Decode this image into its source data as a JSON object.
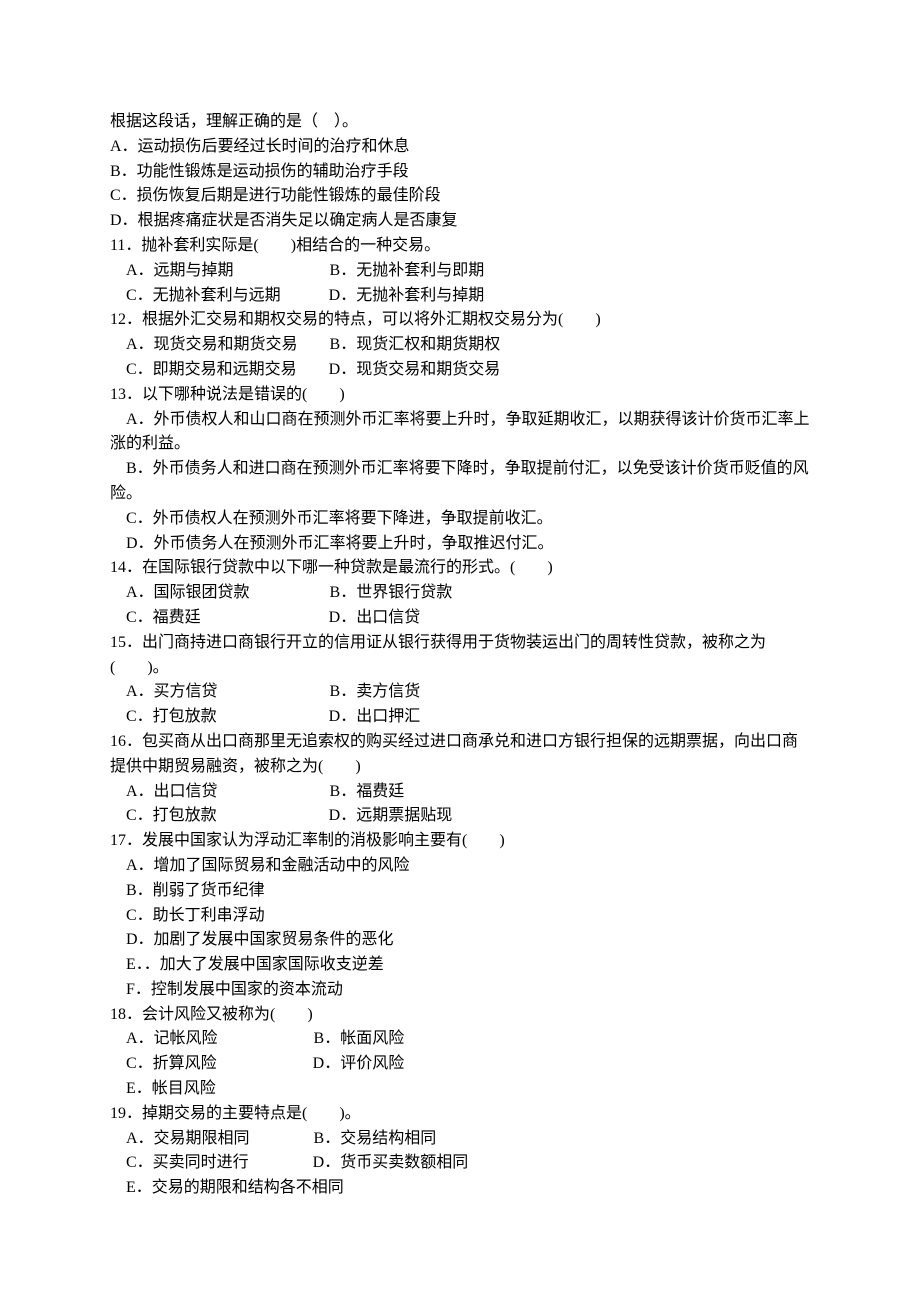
{
  "intro": {
    "prompt": "根据这段话，理解正确的是（　）。",
    "options": {
      "A": "A．运动损伤后要经过长时间的治疗和休息",
      "B": "B．功能性锻炼是运动损伤的辅助治疗手段",
      "C": "C．损伤恢复后期是进行功能性锻炼的最佳阶段",
      "D": "D．根据疼痛症状是否消失足以确定病人是否康复"
    }
  },
  "q11": {
    "stem": "11．抛补套利实际是(　　)相结合的一种交易。",
    "row1": "　A．远期与掉期　　　　　　B．无抛补套利与即期",
    "row2": "　C．无抛补套利与远期　　　D．无抛补套利与掉期"
  },
  "q12": {
    "stem": "12．根据外汇交易和期权交易的特点，可以将外汇期权交易分为(　　)",
    "row1": "　A．现货交易和期货交易　　B．现货汇权和期货期权",
    "row2": "　C．即期交易和远期交易　　D．现货交易和期货交易"
  },
  "q13": {
    "stem": "13．以下哪种说法是错误的(　　)",
    "A": "　A．外币债权人和山口商在预测外币汇率将要上升时，争取延期收汇，以期获得该计价货币汇率上涨的利益。",
    "B": "　B．外币债务人和进口商在预测外币汇率将要下降时，争取提前付汇，以免受该计价货币贬值的风险。",
    "C": "　C．外币债权人在预测外币汇率将要下降进，争取提前收汇。",
    "D": "　D．外币债务人在预测外币汇率将要上升时，争取推迟付汇。"
  },
  "q14": {
    "stem": "14．在国际银行贷款中以下哪一种贷款是最流行的形式。(　　)",
    "row1": "　A．国际银团贷款　　　　　B．世界银行贷款",
    "row2": "　C．福费廷　　　　　　　　D．出口信贷"
  },
  "q15": {
    "stem": "15．出门商持进口商银行开立的信用证从银行获得用于货物装运出门的周转性贷款，被称之为(　　)。",
    "row1": "　A．买方信贷　　　　　　　B．卖方信货",
    "row2": "　C．打包放款　　　　　　　D．出口押汇"
  },
  "q16": {
    "stem": "16．包买商从出口商那里无追索权的购买经过进口商承兑和进口方银行担保的远期票据，向出口商提供中期贸易融资，被称之为(　　)",
    "row1": "　A．出口信贷　　　　　　　B．福费廷",
    "row2": "　C．打包放款　　　　　　　D．远期票据贴现"
  },
  "q17": {
    "stem": "17．发展中国家认为浮动汇率制的消极影响主要有(　　)",
    "A": "　A．增加了国际贸易和金融活动中的风险",
    "B": "　B．削弱了货币纪律",
    "C": "　C．助长丁利串浮动",
    "D": "　D．加剧了发展中国家贸易条件的恶化",
    "E": "　E．．加大了发展中国家国际收支逆差",
    "F": "　F．控制发展中国家的资本流动"
  },
  "q18": {
    "stem": "18．会计风险又被称为(　　)",
    "row1": "　A．记帐风险　　　　　　B．帐面风险",
    "row2": "　C．折算风险　　　　　　D．评价风险",
    "row3": "　E．帐目风险"
  },
  "q19": {
    "stem": "19．掉期交易的主要特点是(　　)。",
    "row1": "　A．交易期限相同　　　　B．交易结构相同",
    "row2": "　C．买卖同时进行　　　　D．货币买卖数额相同",
    "row3": "　E．交易的期限和结构各不相同"
  }
}
